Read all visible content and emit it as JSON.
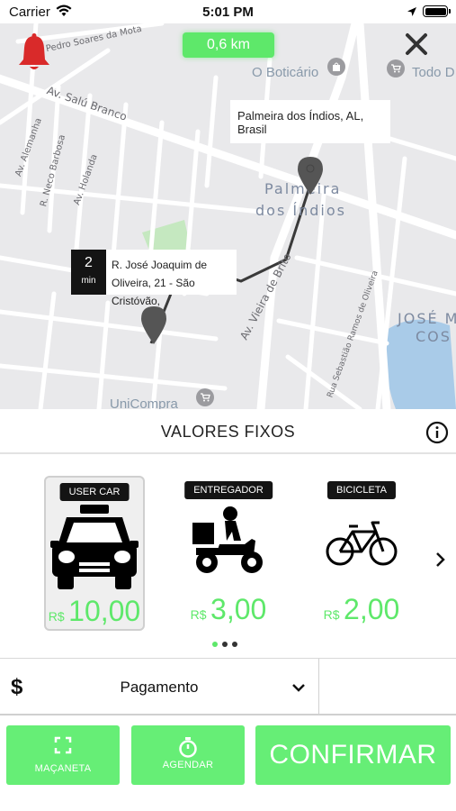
{
  "status_bar": {
    "carrier": "Carrier",
    "time": "5:01 PM"
  },
  "map": {
    "distance": "0,6 km",
    "streets": [
      "Pedro Soares da Mota",
      "Av. Salú Branco",
      "Av. Alemanha",
      "R. Neco Barbosa",
      "Av. Holanda",
      "Av. Vieira de Brito",
      "Rua Sebastião Ramos de Oliveira"
    ],
    "places": [
      "Palmeira",
      "dos Índios",
      "JOSÉ M",
      "COS"
    ],
    "pois": [
      "O Boticário",
      "Todo D",
      "UniCompra"
    ],
    "destination": "Palmeira dos Índios, AL, Brasil",
    "origin": {
      "minutes": "2",
      "minutes_unit": "min",
      "address_line1": "R. José Joaquim de",
      "address_line2": "Oliveira, 21 - São Cristóvão,"
    }
  },
  "section": {
    "title": "VALORES FIXOS"
  },
  "vehicles": [
    {
      "name": "USER CAR",
      "currency": "R$",
      "price": "10,00",
      "selected": true
    },
    {
      "name": "ENTREGADOR",
      "currency": "R$",
      "price": "3,00",
      "selected": false
    },
    {
      "name": "BICICLETA",
      "currency": "R$",
      "price": "2,00",
      "selected": false
    }
  ],
  "payment": {
    "symbol": "$",
    "label": "Pagamento"
  },
  "buttons": {
    "macaneta": "MAÇANETA",
    "agendar": "AGENDAR",
    "confirmar": "CONFIRMAR"
  },
  "colors": {
    "accent": "#5ee86a",
    "dark": "#141414",
    "map_bg": "#e9e9eb"
  }
}
